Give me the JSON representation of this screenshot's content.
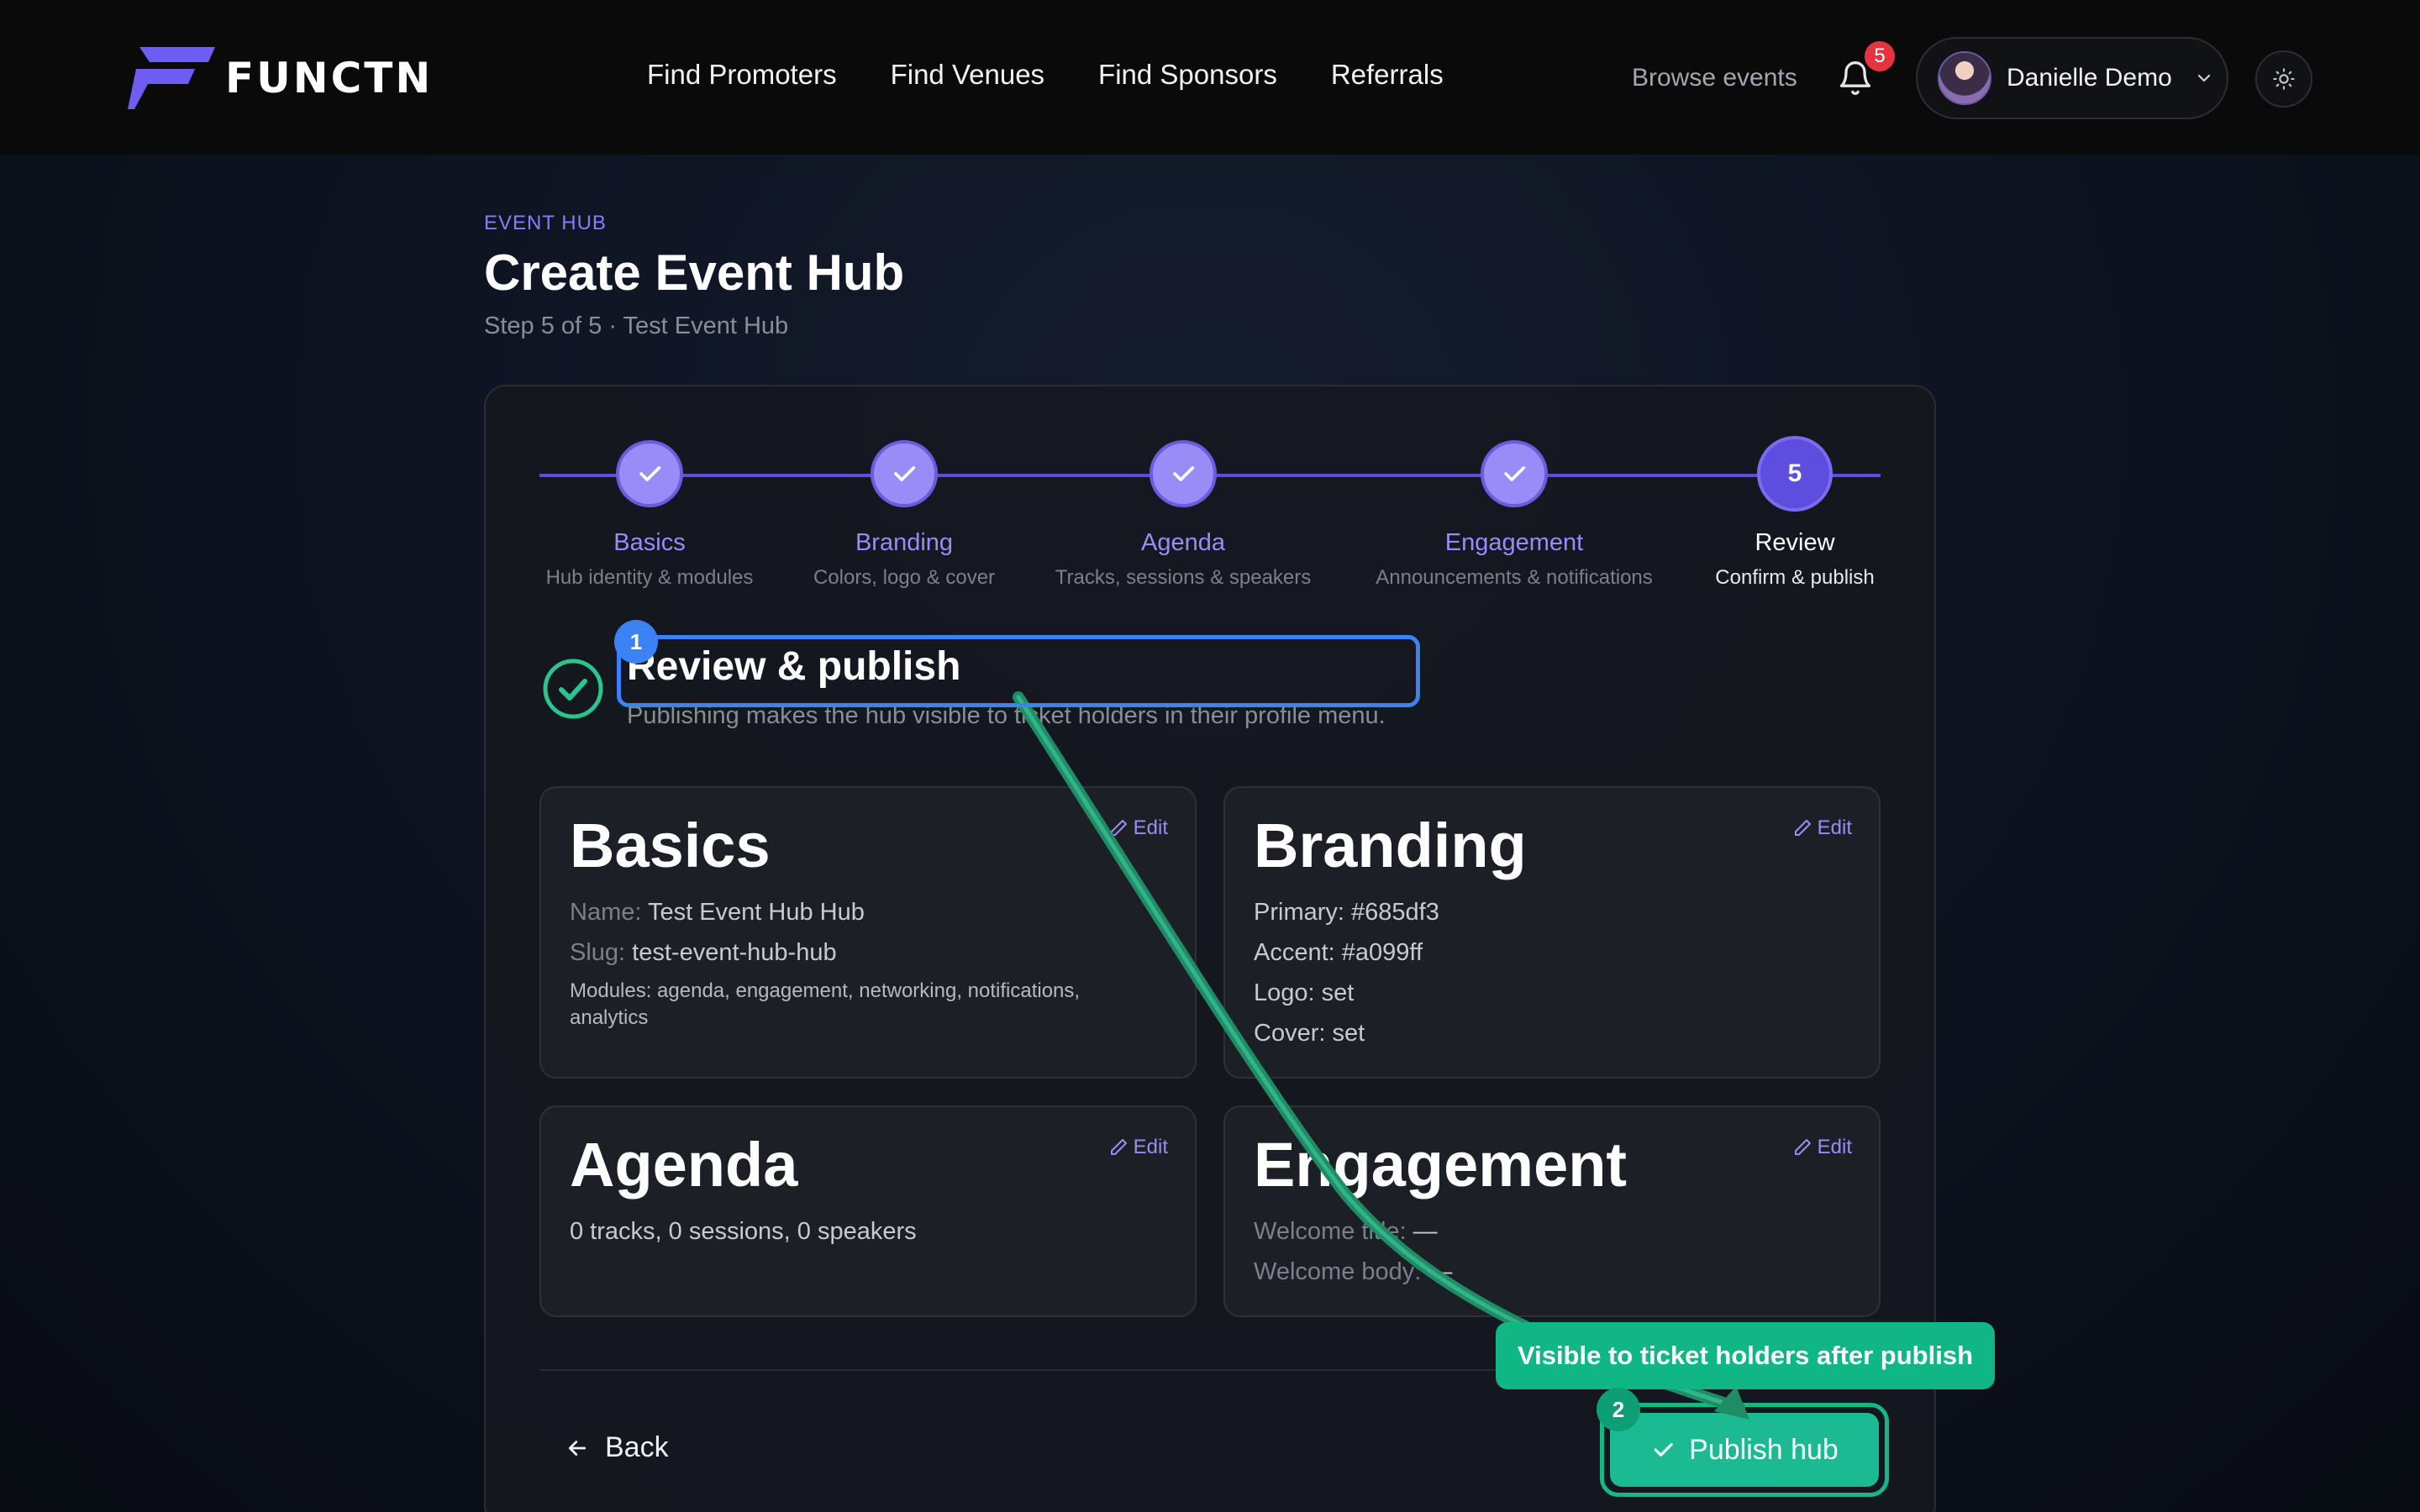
{
  "brand": {
    "name": "FUNCTN",
    "accent": "#6d5df2"
  },
  "nav": {
    "items": [
      "Find Promoters",
      "Find Venues",
      "Find Sponsors",
      "Referrals"
    ]
  },
  "header": {
    "browse_label": "Browse events",
    "notifications_count": "5",
    "user_name": "Danielle Demo"
  },
  "page": {
    "eyebrow": "EVENT HUB",
    "title": "Create Event Hub",
    "subtitle": "Step 5 of 5 · Test Event Hub"
  },
  "steps": [
    {
      "label": "Basics",
      "desc": "Hub identity & modules",
      "state": "done"
    },
    {
      "label": "Branding",
      "desc": "Colors, logo & cover",
      "state": "done"
    },
    {
      "label": "Agenda",
      "desc": "Tracks, sessions & speakers",
      "state": "done"
    },
    {
      "label": "Engagement",
      "desc": "Announcements & notifications",
      "state": "done"
    },
    {
      "label": "Review",
      "desc": "Confirm & publish",
      "state": "active",
      "number": "5"
    }
  ],
  "review": {
    "title": "Review & publish",
    "subtitle": "Publishing makes the hub visible to ticket holders in their profile menu."
  },
  "sections": {
    "edit_label": "Edit",
    "basics": {
      "title": "Basics",
      "name_key": "Name:",
      "name_val": "Test Event Hub Hub",
      "slug_key": "Slug:",
      "slug_val": "test-event-hub-hub",
      "modules": "Modules: agenda, engagement, networking, notifications, analytics"
    },
    "branding": {
      "title": "Branding",
      "primary": "Primary: #685df3",
      "accent": "Accent: #a099ff",
      "logo": "Logo: set",
      "cover": "Cover: set"
    },
    "agenda": {
      "title": "Agenda",
      "summary": "0 tracks, 0 sessions, 0 speakers"
    },
    "engagement": {
      "title": "Engagement",
      "welcome_title_key": "Welcome title:",
      "welcome_title_val": "—",
      "welcome_body_key": "Welcome body:",
      "welcome_body_val": "—"
    }
  },
  "footer": {
    "back_label": "Back",
    "publish_label": "Publish hub"
  },
  "annotations": {
    "marker1": "1",
    "marker2": "2",
    "tooltip": "Visible to ticket holders after publish"
  }
}
